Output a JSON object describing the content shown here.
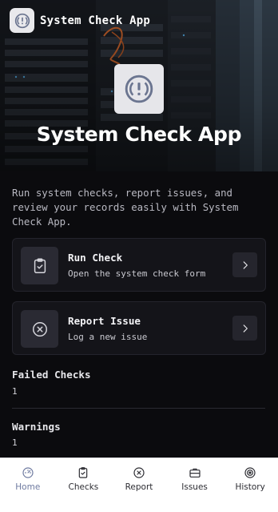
{
  "header": {
    "app_title": "System Check App",
    "hero_title": "System Check App",
    "app_icon": "alert-circle-icon"
  },
  "intro": "Run system checks, report issues, and review your records easily with System Check App.",
  "cards": [
    {
      "title": "Run Check",
      "subtitle": "Open the system check form",
      "icon": "clipboard-check-icon"
    },
    {
      "title": "Report Issue",
      "subtitle": "Log a new issue",
      "icon": "x-circle-icon"
    }
  ],
  "stats": [
    {
      "label": "Failed Checks",
      "value": "1"
    },
    {
      "label": "Warnings",
      "value": "1"
    }
  ],
  "nav": [
    {
      "label": "Home",
      "icon": "gauge-icon",
      "active": true
    },
    {
      "label": "Checks",
      "icon": "clipboard-check-icon",
      "active": false
    },
    {
      "label": "Report",
      "icon": "x-circle-icon",
      "active": false
    },
    {
      "label": "Issues",
      "icon": "briefcase-icon",
      "active": false
    },
    {
      "label": "History",
      "icon": "history-icon",
      "active": false
    }
  ],
  "colors": {
    "background": "#0b0b0e",
    "card": "#141419",
    "nav_active": "#6e7aa0",
    "nav_bg": "#ffffff"
  }
}
